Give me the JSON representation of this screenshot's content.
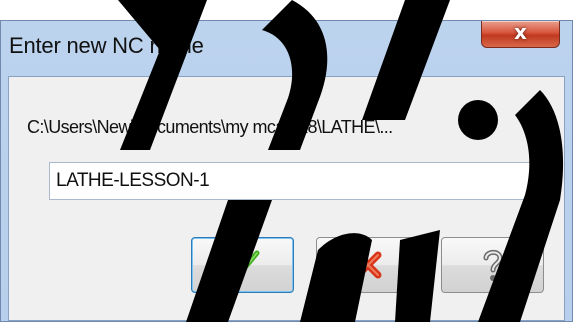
{
  "window": {
    "title": "Enter new NC name",
    "close_glyph": "x"
  },
  "dialog": {
    "path_text": "C:\\Users\\New\\Documents\\my mcamx8\\LATHE\\...",
    "nc_name_value": "LATHE-LESSON-1"
  },
  "buttons": {
    "ok_icon": "checkmark-icon",
    "cancel_icon": "x-mark-icon",
    "help_icon": "question-mark-icon"
  },
  "colors": {
    "title_bar": "#b9d1ee",
    "close_button": "#c9442a",
    "ok_check": "#3fae1e",
    "cancel_x": "#d8361a",
    "watermark": "#000000"
  }
}
